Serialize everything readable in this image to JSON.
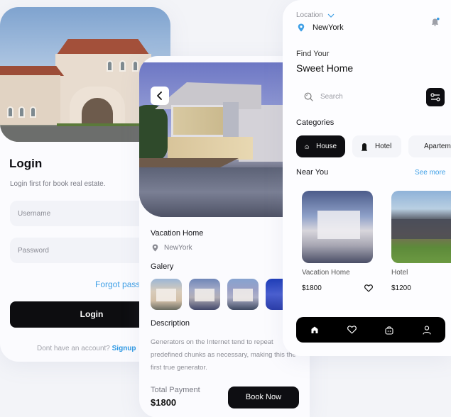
{
  "login": {
    "title": "Login",
    "subtitle": "Login first for book real estate.",
    "username_placeholder": "Username",
    "password_placeholder": "Password",
    "forgot_label": "Forgot password?",
    "login_button": "Login",
    "no_account_text": "Dont have an account?",
    "signup_label": "Signup"
  },
  "detail": {
    "back_icon": "chevron-left-icon",
    "title": "Vacation Home",
    "location": "NewYork",
    "gallery_title": "Galery",
    "gallery_count_visible": 4,
    "description_title": "Description",
    "description": "Generators on the Internet tend to repeat predefined chunks as necessary, making this the first true generator.",
    "total_label": "Total Payment",
    "total_value": "$1800",
    "book_button": "Book Now"
  },
  "home": {
    "location_label": "Location",
    "location_value": "NewYork",
    "notification_icon": "bell-icon",
    "find_your": "Find Your",
    "sweet_home": "Sweet Home",
    "search_placeholder": "Search",
    "categories_title": "Categories",
    "categories": [
      {
        "label": "House",
        "icon": "house-icon",
        "active": true
      },
      {
        "label": "Hotel",
        "icon": "hotel-icon",
        "active": false
      },
      {
        "label": "Apartement",
        "icon": "apartment-icon",
        "active": false
      }
    ],
    "near_title": "Near You",
    "see_more": "See more",
    "near": [
      {
        "name": "Vacation Home",
        "price": "$1800",
        "favorite_icon": "heart-icon"
      },
      {
        "name": "Hotel",
        "price": "$1200"
      }
    ],
    "nav": [
      {
        "name": "home",
        "icon": "home-icon",
        "active": true
      },
      {
        "name": "favorites",
        "icon": "heart-icon",
        "active": false
      },
      {
        "name": "bag",
        "icon": "shopping-bag-icon",
        "active": false
      },
      {
        "name": "profile",
        "icon": "user-icon",
        "active": false
      }
    ]
  },
  "colors": {
    "accent_blue": "#3d9fe6",
    "dark": "#0e0e12",
    "background": "#f3f4f8"
  }
}
